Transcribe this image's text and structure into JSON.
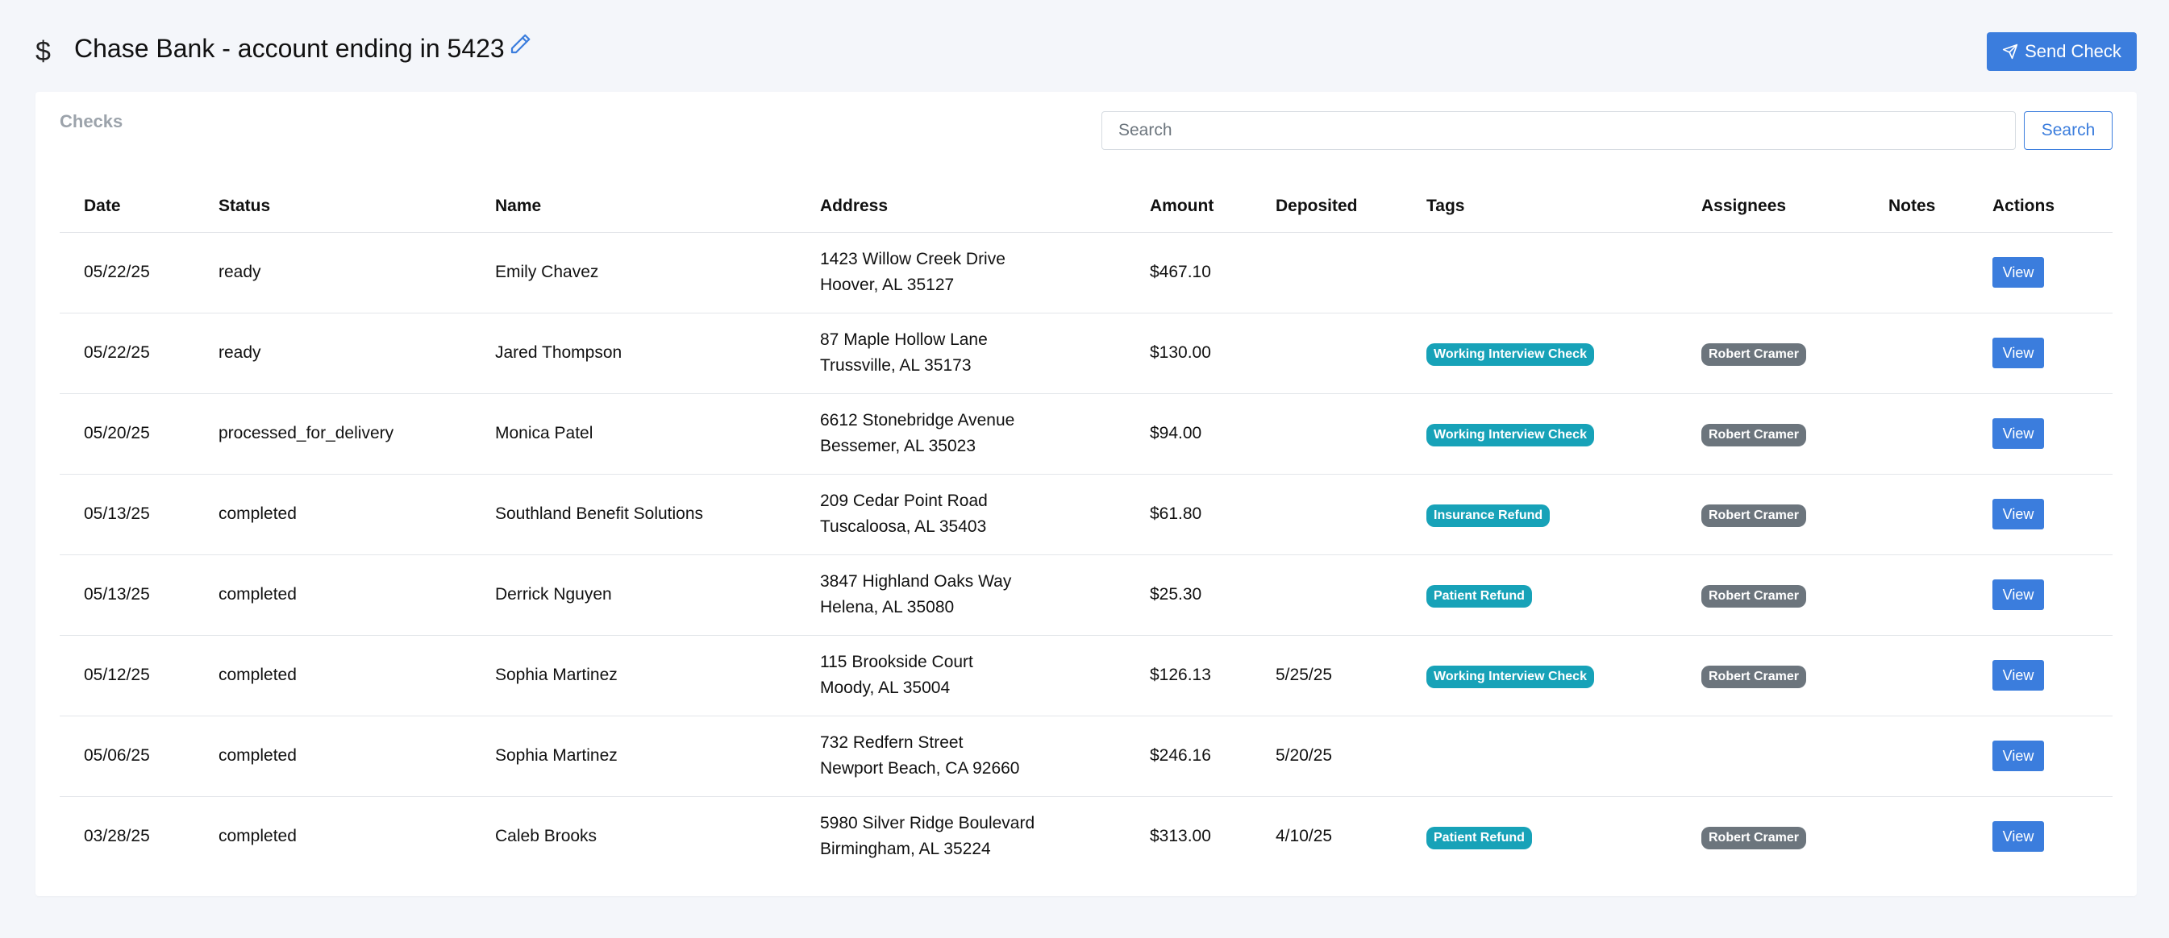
{
  "header": {
    "title": "Chase Bank - account ending in 5423",
    "icon": "dollar-icon",
    "edit_icon": "pencil-icon",
    "send_label": "Send Check"
  },
  "colors": {
    "primary": "#3b7ddd",
    "tag": "#17a2b8",
    "assignee": "#6c757d"
  },
  "card": {
    "title": "Checks",
    "search_placeholder": "Search",
    "search_label": "Search"
  },
  "table": {
    "columns": [
      "Date",
      "Status",
      "Name",
      "Address",
      "Amount",
      "Deposited",
      "Tags",
      "Assignees",
      "Notes",
      "Actions"
    ],
    "rows": [
      {
        "date": "05/22/25",
        "status": "ready",
        "name": "Emily Chavez",
        "address1": "1423 Willow Creek Drive",
        "address2": "Hoover, AL 35127",
        "amount": "$467.10",
        "deposited": "",
        "tag": "",
        "assignee": "",
        "notes": "",
        "action": "View"
      },
      {
        "date": "05/22/25",
        "status": "ready",
        "name": "Jared Thompson",
        "address1": "87 Maple Hollow Lane",
        "address2": "Trussville, AL 35173",
        "amount": "$130.00",
        "deposited": "",
        "tag": "Working Interview Check",
        "assignee": "Robert Cramer",
        "notes": "",
        "action": "View"
      },
      {
        "date": "05/20/25",
        "status": "processed_for_delivery",
        "name": "Monica Patel",
        "address1": "6612 Stonebridge Avenue",
        "address2": "Bessemer, AL 35023",
        "amount": "$94.00",
        "deposited": "",
        "tag": "Working Interview Check",
        "assignee": "Robert Cramer",
        "notes": "",
        "action": "View"
      },
      {
        "date": "05/13/25",
        "status": "completed",
        "name": "Southland Benefit Solutions",
        "address1": "209 Cedar Point Road",
        "address2": "Tuscaloosa, AL 35403",
        "amount": "$61.80",
        "deposited": "",
        "tag": "Insurance Refund",
        "assignee": "Robert Cramer",
        "notes": "",
        "action": "View"
      },
      {
        "date": "05/13/25",
        "status": "completed",
        "name": "Derrick Nguyen",
        "address1": "3847 Highland Oaks Way",
        "address2": "Helena, AL 35080",
        "amount": "$25.30",
        "deposited": "",
        "tag": "Patient Refund",
        "assignee": "Robert Cramer",
        "notes": "",
        "action": "View"
      },
      {
        "date": "05/12/25",
        "status": "completed",
        "name": "Sophia Martinez",
        "address1": "115 Brookside Court",
        "address2": "Moody, AL 35004",
        "amount": "$126.13",
        "deposited": "5/25/25",
        "tag": "Working Interview Check",
        "assignee": "Robert Cramer",
        "notes": "",
        "action": "View"
      },
      {
        "date": "05/06/25",
        "status": "completed",
        "name": "Sophia Martinez",
        "address1": "732 Redfern Street",
        "address2": "Newport Beach, CA 92660",
        "amount": "$246.16",
        "deposited": "5/20/25",
        "tag": "",
        "assignee": "",
        "notes": "",
        "action": "View"
      },
      {
        "date": "03/28/25",
        "status": "completed",
        "name": "Caleb Brooks",
        "address1": "5980 Silver Ridge Boulevard",
        "address2": "Birmingham, AL 35224",
        "amount": "$313.00",
        "deposited": "4/10/25",
        "tag": "Patient Refund",
        "assignee": "Robert Cramer",
        "notes": "",
        "action": "View"
      }
    ]
  }
}
